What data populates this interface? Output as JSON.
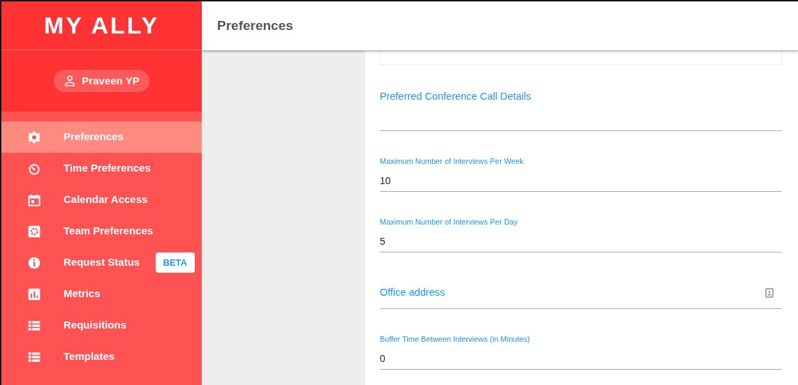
{
  "logo": "MY ALLY",
  "user": {
    "name": "Praveen YP"
  },
  "nav": [
    {
      "label": "Preferences",
      "kind": "gear",
      "selected": true
    },
    {
      "label": "Time Preferences",
      "kind": "timer",
      "selected": false
    },
    {
      "label": "Calendar Access",
      "kind": "calendar",
      "selected": false
    },
    {
      "label": "Team Preferences",
      "kind": "gearbox",
      "selected": false
    },
    {
      "label": "Request Status",
      "kind": "info",
      "selected": false,
      "badge": "BETA"
    },
    {
      "label": "Metrics",
      "kind": "chart",
      "selected": false
    },
    {
      "label": "Requisitions",
      "kind": "list",
      "selected": false
    },
    {
      "label": "Templates",
      "kind": "list",
      "selected": false
    }
  ],
  "header": {
    "title": "Preferences"
  },
  "fields": [
    {
      "kind": "select"
    },
    {
      "kind": "heading",
      "label": "Preferred Conference Call Details"
    },
    {
      "kind": "input",
      "label": "Maximum Number of Interviews Per Week",
      "value": "10"
    },
    {
      "kind": "input",
      "label": "Maximum Number of Interviews Per Day",
      "value": "5"
    },
    {
      "kind": "address",
      "label": "Office address"
    },
    {
      "kind": "input",
      "label": "Buffer Time Between Interviews (in Minutes)",
      "value": "0"
    }
  ]
}
